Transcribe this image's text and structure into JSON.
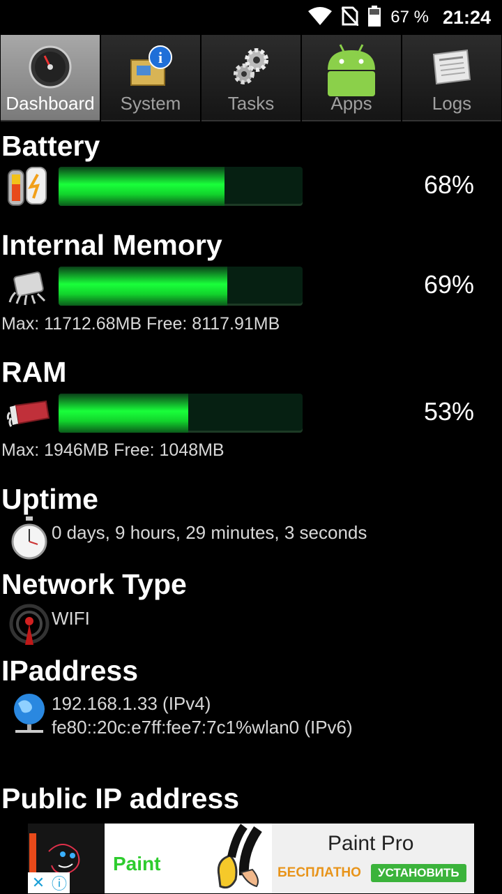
{
  "status_bar": {
    "battery_text": "67 %",
    "time": "21:24"
  },
  "tabs": [
    {
      "label": "Dashboard",
      "icon": "gauge-icon",
      "active": true
    },
    {
      "label": "System",
      "icon": "system-info-icon",
      "active": false
    },
    {
      "label": "Tasks",
      "icon": "gears-icon",
      "active": false
    },
    {
      "label": "Apps",
      "icon": "android-icon",
      "active": false
    },
    {
      "label": "Logs",
      "icon": "newspaper-icon",
      "active": false
    }
  ],
  "battery": {
    "title": "Battery",
    "percent_text": "68%",
    "level": 0.68
  },
  "internal_memory": {
    "title": "Internal Memory",
    "percent_text": "69%",
    "level": 0.69,
    "details": "Max: 11712.68MB Free: 8117.91MB"
  },
  "ram": {
    "title": "RAM",
    "percent_text": "53%",
    "level": 0.53,
    "details": "Max: 1946MB Free: 1048MB"
  },
  "uptime": {
    "title": "Uptime",
    "value": "0 days, 9 hours, 29 minutes, 3 seconds"
  },
  "network": {
    "title": "Network Type",
    "value": "WIFI"
  },
  "ip": {
    "title": "IPaddress",
    "ipv4": "192.168.1.33 (IPv4)",
    "ipv6": "fe80::20c:e7ff:fee7:7c1%wlan0 (IPv6)"
  },
  "public_ip": {
    "title": "Public IP address"
  },
  "ad": {
    "left_label": "Paint",
    "title": "Paint Pro",
    "free_label": "БЕСПЛАТНО",
    "install_label": "УСТАНОВИТЬ"
  },
  "colors": {
    "bar_fill": "#19ff3a",
    "bar_track": "#062012",
    "active_tab": "#a8a8a8"
  }
}
